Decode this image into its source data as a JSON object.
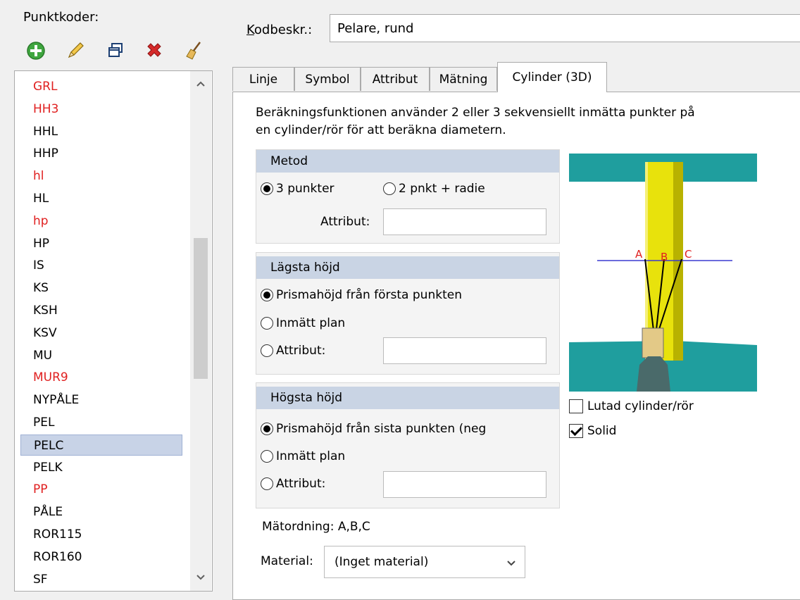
{
  "codes_label": "Punktkoder:",
  "toolbar": {
    "add_icon": "add-icon",
    "edit_icon": "edit-pencil-icon",
    "copy_icon": "copy-window-icon",
    "delete_icon": "delete-x-icon",
    "clean_icon": "broom-icon"
  },
  "codes": [
    {
      "label": "GRL",
      "color": "red"
    },
    {
      "label": "HH3",
      "color": "red"
    },
    {
      "label": "HHL",
      "color": "black"
    },
    {
      "label": "HHP",
      "color": "black"
    },
    {
      "label": "hl",
      "color": "red"
    },
    {
      "label": "HL",
      "color": "black"
    },
    {
      "label": "hp",
      "color": "red"
    },
    {
      "label": "HP",
      "color": "black"
    },
    {
      "label": "IS",
      "color": "black"
    },
    {
      "label": "KS",
      "color": "black"
    },
    {
      "label": "KSH",
      "color": "black"
    },
    {
      "label": "KSV",
      "color": "black"
    },
    {
      "label": "MU",
      "color": "black"
    },
    {
      "label": "MUR9",
      "color": "red"
    },
    {
      "label": "NYPÅLE",
      "color": "black"
    },
    {
      "label": "PEL",
      "color": "black"
    },
    {
      "label": "PELC",
      "color": "black",
      "selected": true
    },
    {
      "label": "PELK",
      "color": "black"
    },
    {
      "label": "PP",
      "color": "red"
    },
    {
      "label": "PÅLE",
      "color": "black"
    },
    {
      "label": "ROR115",
      "color": "black"
    },
    {
      "label": "ROR160",
      "color": "black"
    },
    {
      "label": "SF",
      "color": "black"
    }
  ],
  "kodbeskr": {
    "label_pre": "K",
    "label_post": "odbeskr.:",
    "value": "Pelare, rund"
  },
  "tabs": [
    {
      "label": "Linje"
    },
    {
      "label": "Symbol"
    },
    {
      "label": "Attribut"
    },
    {
      "label": "Mätning"
    },
    {
      "label": "Cylinder (3D)",
      "active": true
    }
  ],
  "description": {
    "line1": "Beräkningsfunktionen använder 2 eller 3 sekvensiellt inmätta punkter på",
    "line2": "en cylinder/rör för att beräkna diametern."
  },
  "metod": {
    "title": "Metod",
    "opt1": "3 punkter",
    "opt2": "2 pnkt + radie",
    "attr_label": "Attribut:",
    "attr_value": ""
  },
  "lagsta": {
    "title": "Lägsta höjd",
    "opt1": "Prismahöjd från första punkten",
    "opt2": "Inmätt plan",
    "opt3": "Attribut:",
    "attr_value": ""
  },
  "hogsta": {
    "title": "Högsta höjd",
    "opt1": "Prismahöjd från sista punkten (neg",
    "opt2": "Inmätt plan",
    "opt3": "Attribut:",
    "attr_value": ""
  },
  "illustration_labels": {
    "a": "A",
    "b": "B",
    "c": "C"
  },
  "options": {
    "lutad": "Lutad cylinder/rör",
    "lutad_checked": false,
    "solid": "Solid",
    "solid_checked": true
  },
  "order": "Mätordning: A,B,C",
  "material": {
    "label": "Material:",
    "value": "(Inget material)"
  },
  "colors": {
    "red_code": "#e02020",
    "group_header": "#c9d4e4",
    "selection": "#c8d3e7",
    "teal": "#1f9e9e",
    "yellow": "#e8e20c"
  }
}
